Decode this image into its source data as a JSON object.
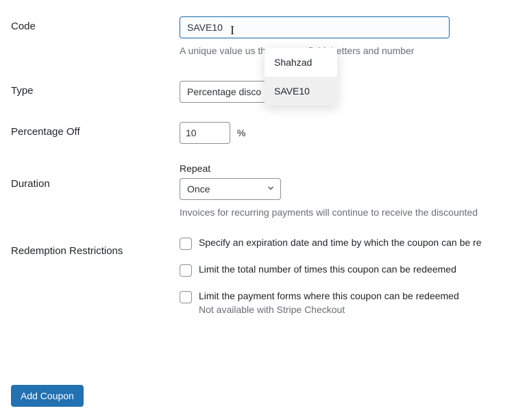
{
  "form": {
    "code": {
      "label": "Code",
      "value": "SAVE10",
      "helper": "A unique value us                       the coupon field. Letters and number"
    },
    "type": {
      "label": "Type",
      "value": "Percentage disco"
    },
    "percentage": {
      "label": "Percentage Off",
      "value": "10",
      "suffix": "%"
    },
    "duration": {
      "label": "Duration",
      "subhead": "Repeat",
      "value": "Once",
      "helper": "Invoices for recurring payments will continue to receive the discounted"
    },
    "restrictions": {
      "label": "Redemption Restrictions",
      "expire": "Specify an expiration date and time by which the coupon can be re",
      "limit_total": "Limit the total number of times this coupon can be redeemed",
      "limit_forms": "Limit the payment forms where this coupon can be redeemed",
      "limit_forms_note": "Not available with Stripe Checkout"
    },
    "submit": "Add Coupon"
  },
  "autocomplete": {
    "item1": "Shahzad",
    "item2": "SAVE10"
  }
}
